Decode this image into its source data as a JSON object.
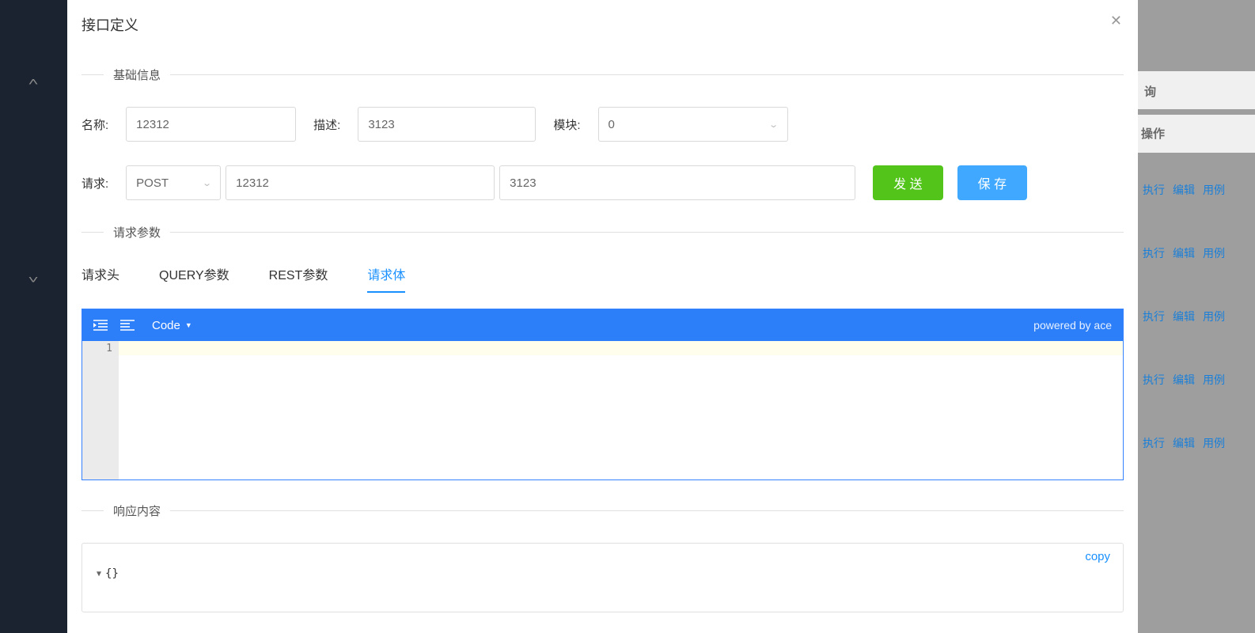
{
  "modal": {
    "title": "接口定义",
    "close": "✕"
  },
  "section_basic": {
    "legend": "基础信息"
  },
  "form": {
    "name_label": "名称:",
    "name_value": "12312",
    "desc_label": "描述:",
    "desc_value": "3123",
    "module_label": "模块:",
    "module_value": "0",
    "request_label": "请求:",
    "method_value": "POST",
    "url_input1": "12312",
    "url_input2": "3123",
    "send_btn": "发 送",
    "save_btn": "保 存"
  },
  "section_params": {
    "legend": "请求参数"
  },
  "tabs": {
    "t1": "请求头",
    "t2": "QUERY参数",
    "t3": "REST参数",
    "t4": "请求体"
  },
  "editor": {
    "code_label": "Code",
    "powered": "powered by ace",
    "line1": "1"
  },
  "section_response": {
    "legend": "响应内容"
  },
  "response": {
    "copy": "copy",
    "object": "{}"
  },
  "background": {
    "query_col": "询",
    "action_col": "操作",
    "exec": "执行",
    "edit": "编辑",
    "usecase": "用例"
  }
}
